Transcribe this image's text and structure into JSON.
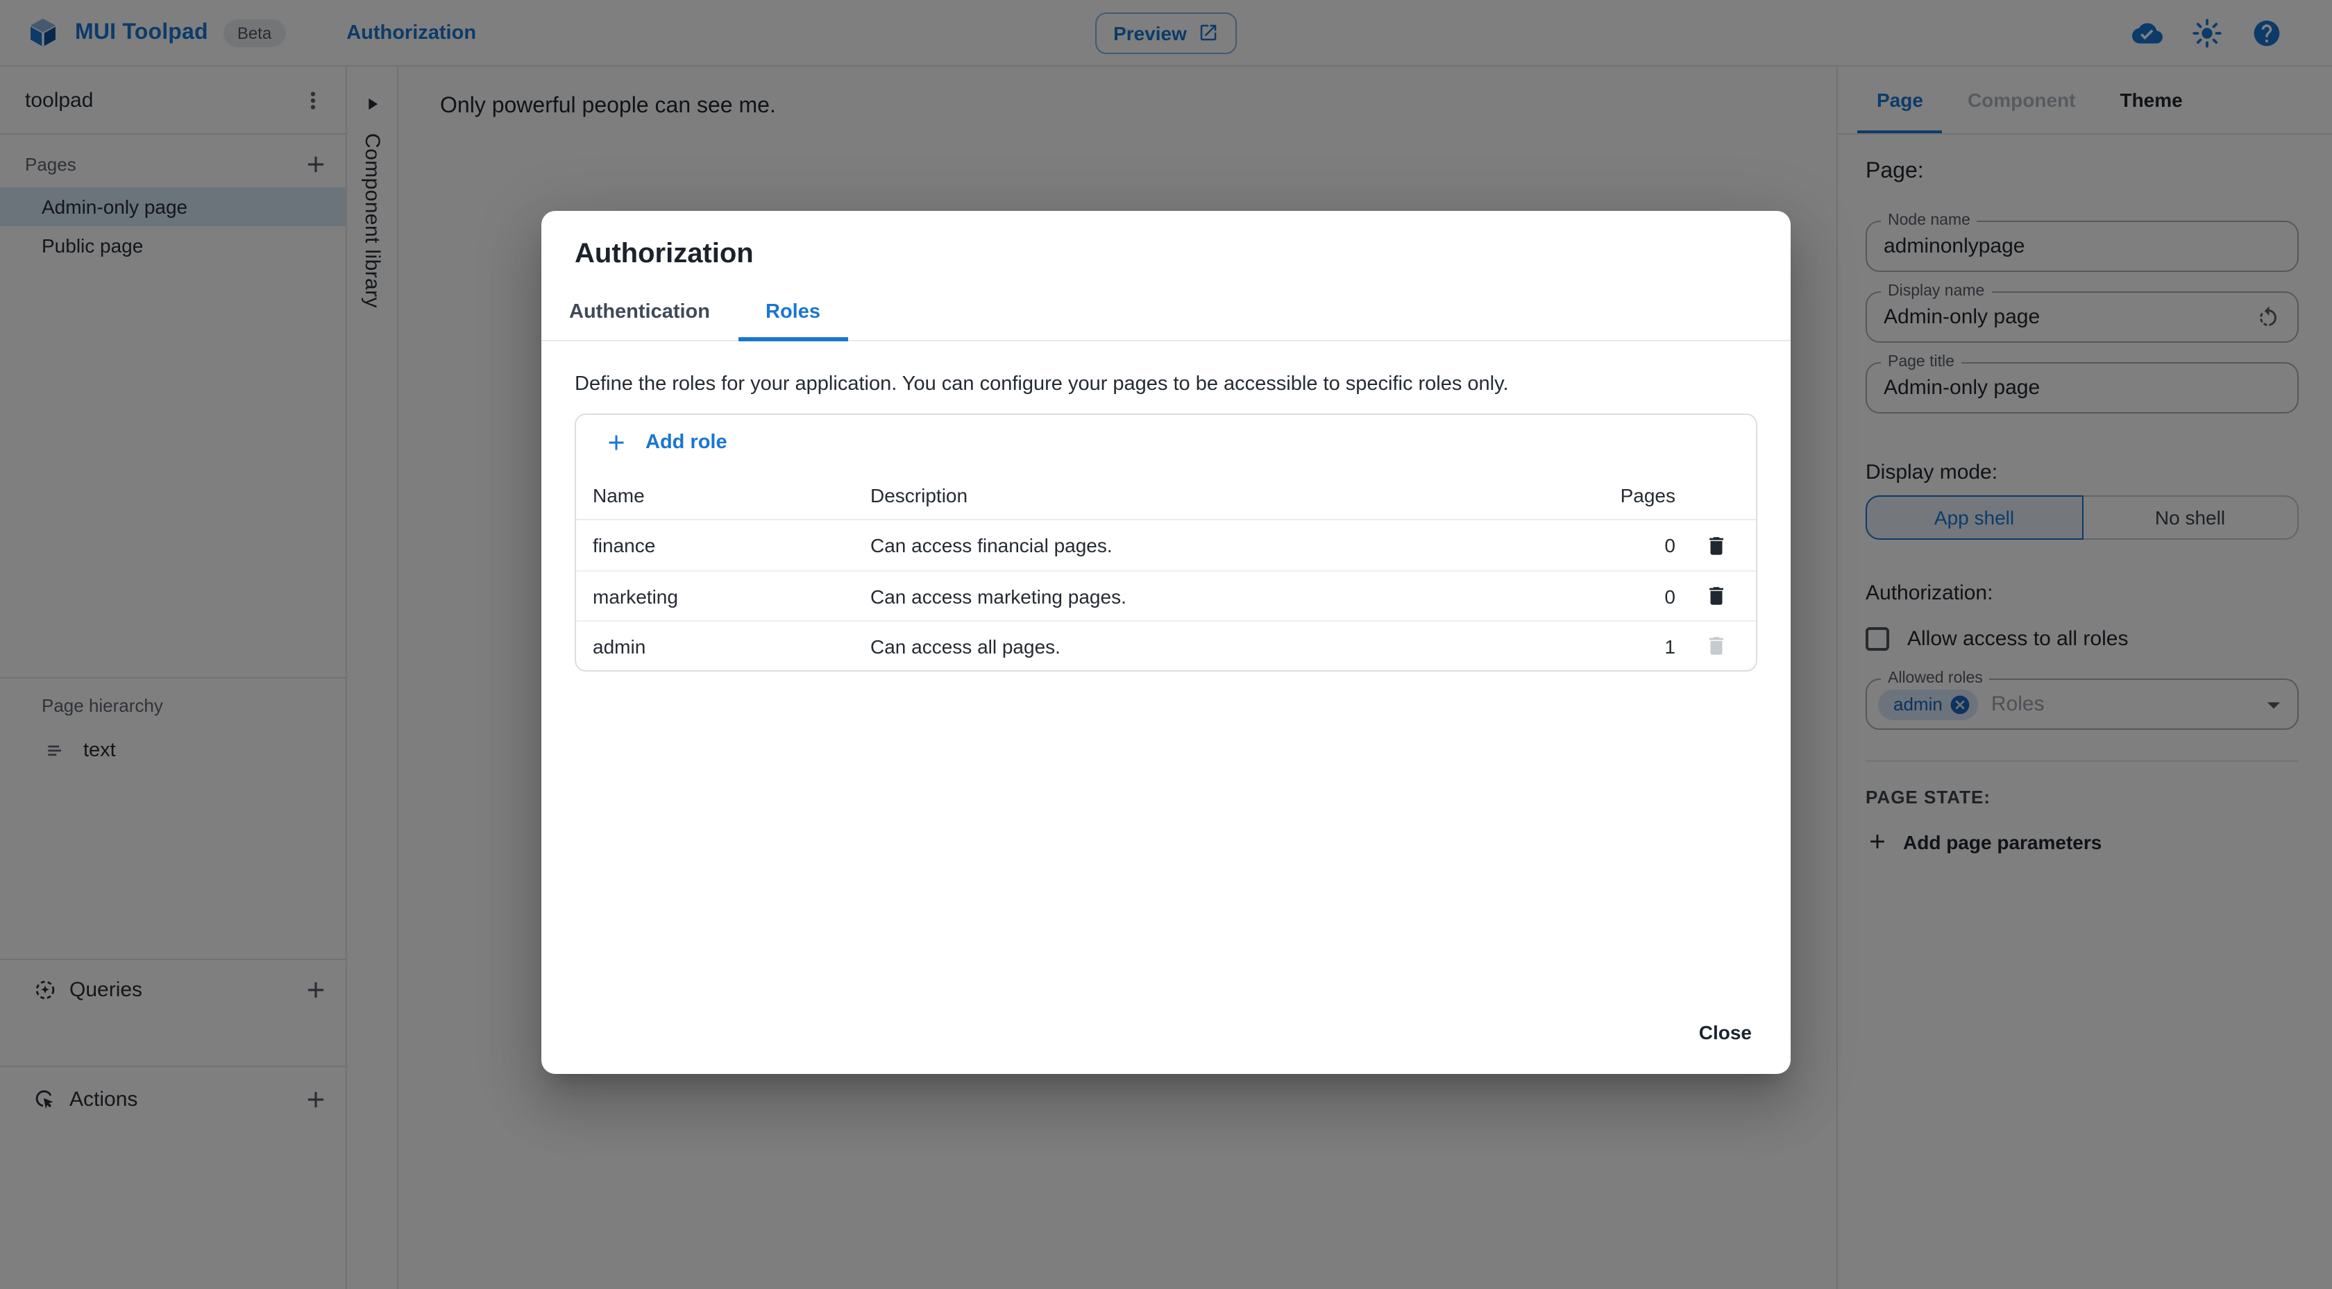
{
  "colors": {
    "primary": "#1976d2",
    "selected_item_bg": "#d9e7f8",
    "chip_bg": "#d8e7f9",
    "backdrop": "rgba(0,0,0,0.5)"
  },
  "icons": {
    "logo": "toolpad-logo",
    "save_status": "cloud-done",
    "theme_toggle": "brightness-sun",
    "help": "help-circle",
    "preview_external": "open-in-new",
    "project_menu": "more-vert",
    "add": "plus",
    "collapse": "triangle-right",
    "text_component": "text-lines",
    "queries": "dashed-circle-star",
    "actions": "ads-click",
    "delete": "trash",
    "reset": "rotate-left",
    "dropdown": "arrow-drop-down",
    "chip_remove": "cancel-circle"
  },
  "header": {
    "app_title": "MUI Toolpad",
    "beta_badge": "Beta",
    "nav_link": "Authorization",
    "preview_button": "Preview"
  },
  "sidebar": {
    "project_name": "toolpad",
    "pages": {
      "title": "Pages",
      "items": [
        {
          "label": "Admin-only page",
          "selected": true
        },
        {
          "label": "Public page",
          "selected": false
        }
      ]
    },
    "hierarchy": {
      "title": "Page hierarchy",
      "items": [
        {
          "label": "text"
        }
      ]
    },
    "queries": {
      "title": "Queries"
    },
    "actions": {
      "title": "Actions"
    }
  },
  "component_library": {
    "label": "Component library"
  },
  "canvas": {
    "text": "Only powerful people can see me."
  },
  "dialog": {
    "title": "Authorization",
    "tabs": [
      {
        "label": "Authentication",
        "active": false
      },
      {
        "label": "Roles",
        "active": true
      }
    ],
    "description": "Define the roles for your application. You can configure your pages to be accessible to specific roles only.",
    "add_role_button": "Add role",
    "table": {
      "columns": [
        "Name",
        "Description",
        "Pages"
      ],
      "rows": [
        {
          "name": "finance",
          "description": "Can access financial pages.",
          "pages": 0,
          "deletable": true
        },
        {
          "name": "marketing",
          "description": "Can access marketing pages.",
          "pages": 0,
          "deletable": true
        },
        {
          "name": "admin",
          "description": "Can access all pages.",
          "pages": 1,
          "deletable": false
        }
      ]
    },
    "close_button": "Close"
  },
  "inspector": {
    "tabs": [
      {
        "label": "Page",
        "active": true
      },
      {
        "label": "Component",
        "disabled": true
      },
      {
        "label": "Theme",
        "active": false
      }
    ],
    "heading": "Page:",
    "fields": [
      {
        "label": "Node name",
        "value": "adminonlypage"
      },
      {
        "label": "Display name",
        "value": "Admin-only page",
        "has_reset": true
      },
      {
        "label": "Page title",
        "value": "Admin-only page"
      }
    ],
    "display_mode": {
      "label": "Display mode:",
      "options": [
        {
          "label": "App shell",
          "selected": true
        },
        {
          "label": "No shell",
          "selected": false
        }
      ]
    },
    "authorization": {
      "label": "Authorization:",
      "checkbox_label": "Allow access to all roles",
      "checkbox_checked": false,
      "allowed_roles": {
        "label": "Allowed roles",
        "chips": [
          "admin"
        ],
        "placeholder": "Roles"
      }
    },
    "page_state": {
      "label": "PAGE STATE:",
      "add_button": "Add page parameters"
    }
  }
}
